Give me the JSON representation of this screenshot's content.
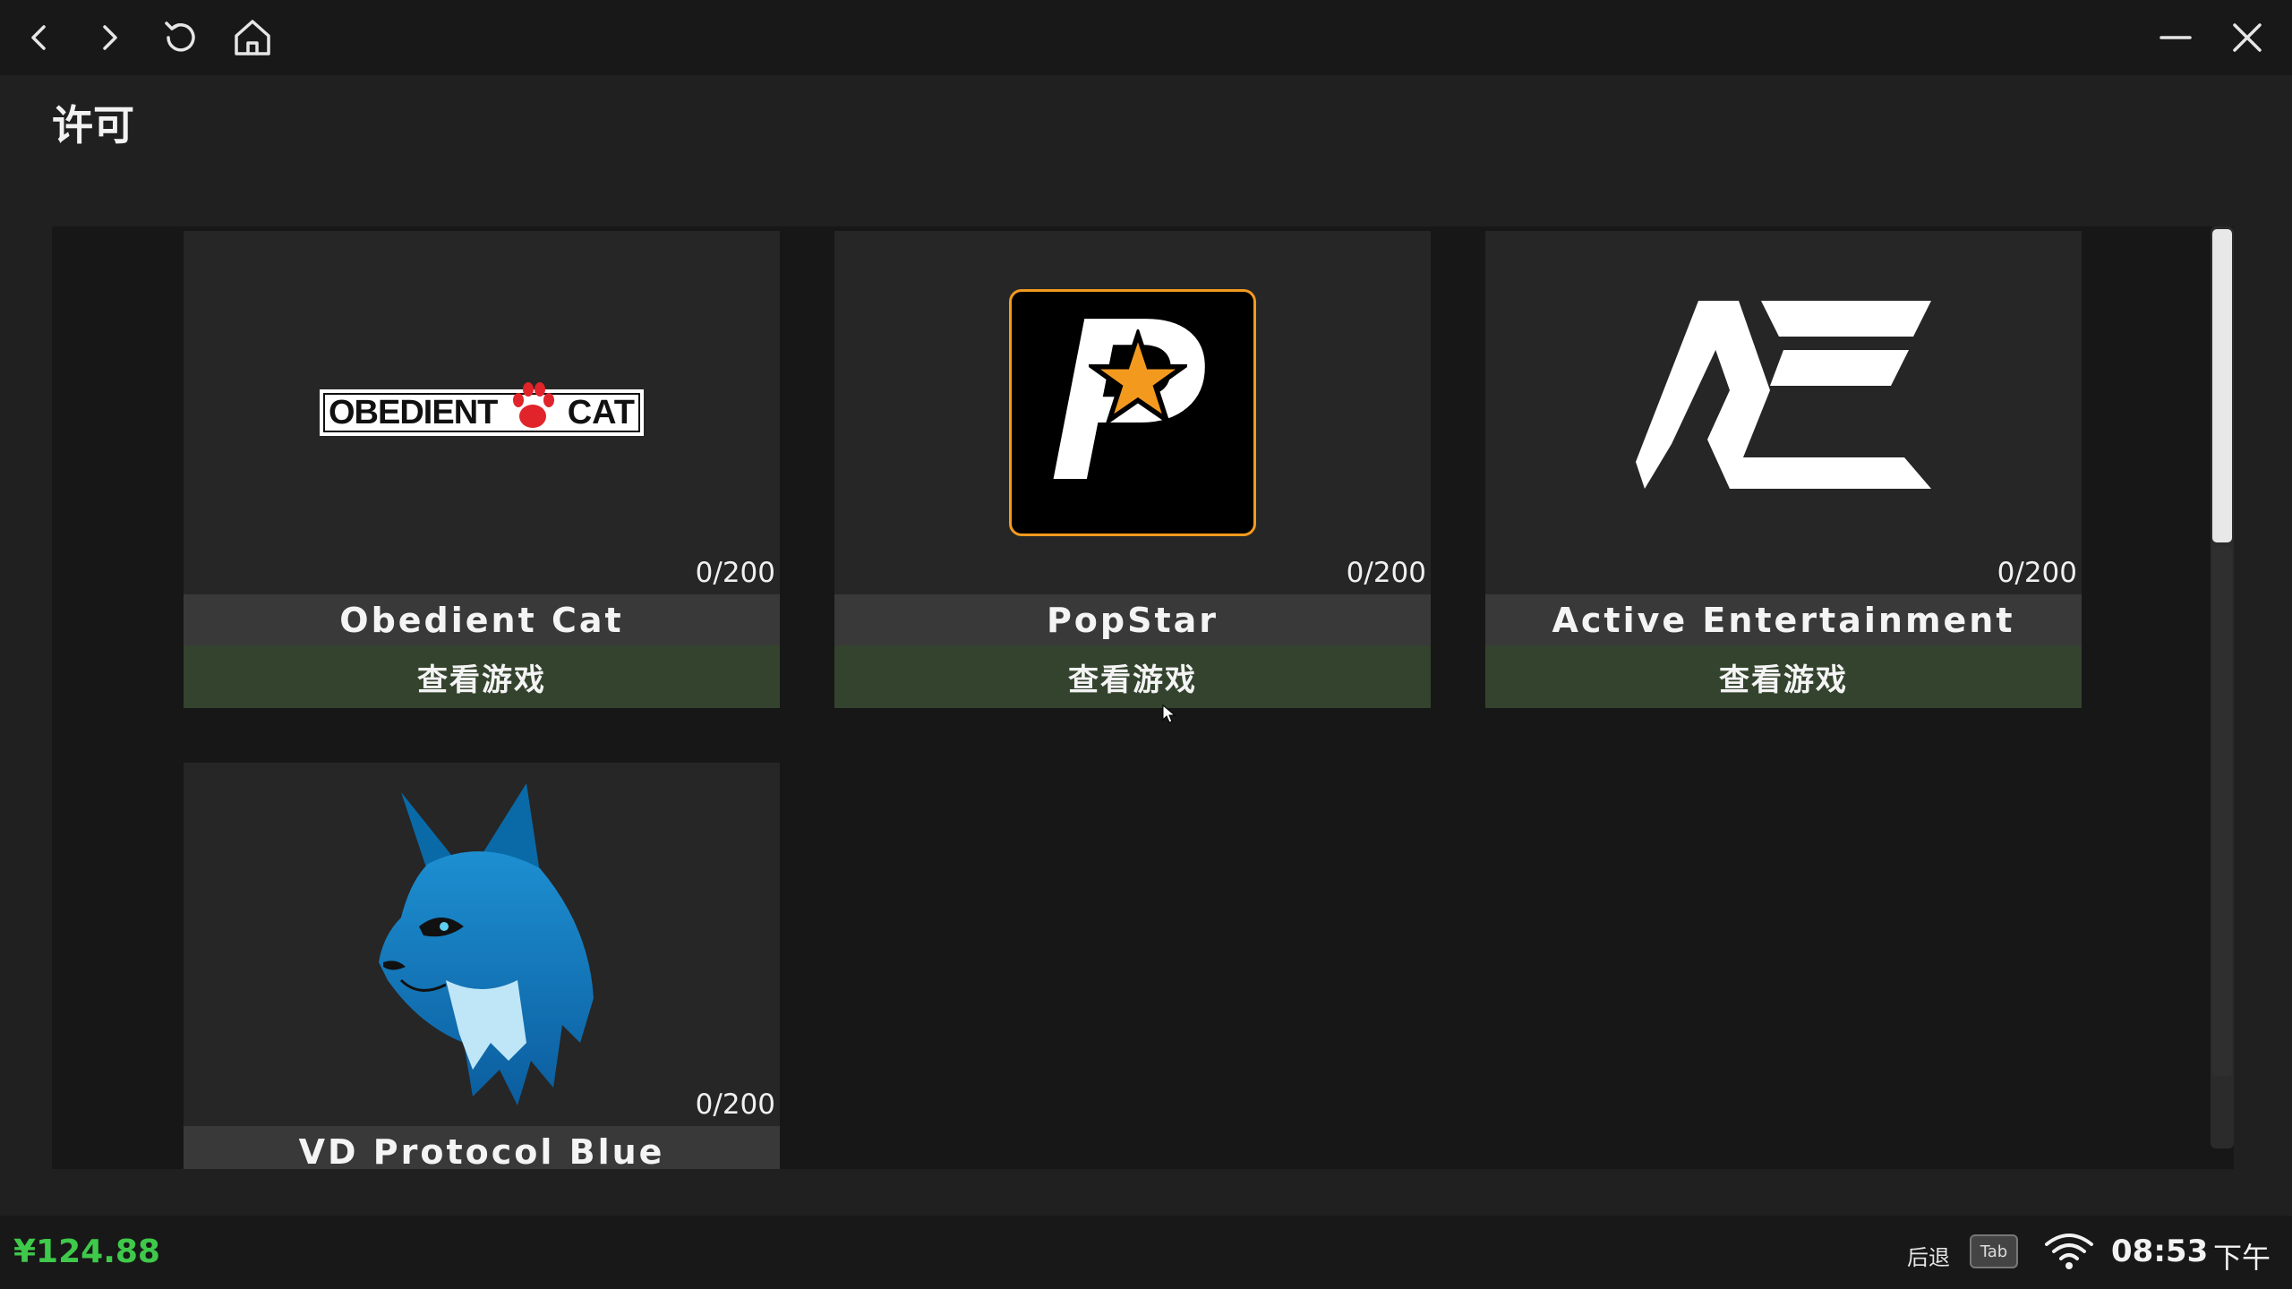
{
  "header": {
    "title": "许可",
    "nav": [
      "back-icon",
      "forward-icon",
      "refresh-icon",
      "home-icon"
    ],
    "window": [
      "minimize-icon",
      "close-icon"
    ]
  },
  "cards": [
    {
      "name": "Obedient Cat",
      "count": "0/200",
      "button": "查看游戏",
      "logo_text_left": "OBEDIENT",
      "logo_text_right": "CAT"
    },
    {
      "name": "PopStar",
      "count": "0/200",
      "button": "查看游戏",
      "logo_letter": "P"
    },
    {
      "name": "Active Entertainment",
      "count": "0/200",
      "button": "查看游戏"
    },
    {
      "name": "VD Protocol Blue",
      "count": "0/200"
    }
  ],
  "footer": {
    "balance": "¥124.88",
    "balance_color": "#3fc94a",
    "back_label": "后退",
    "back_key": "Tab",
    "time": "08:53",
    "ampm": "下午"
  }
}
